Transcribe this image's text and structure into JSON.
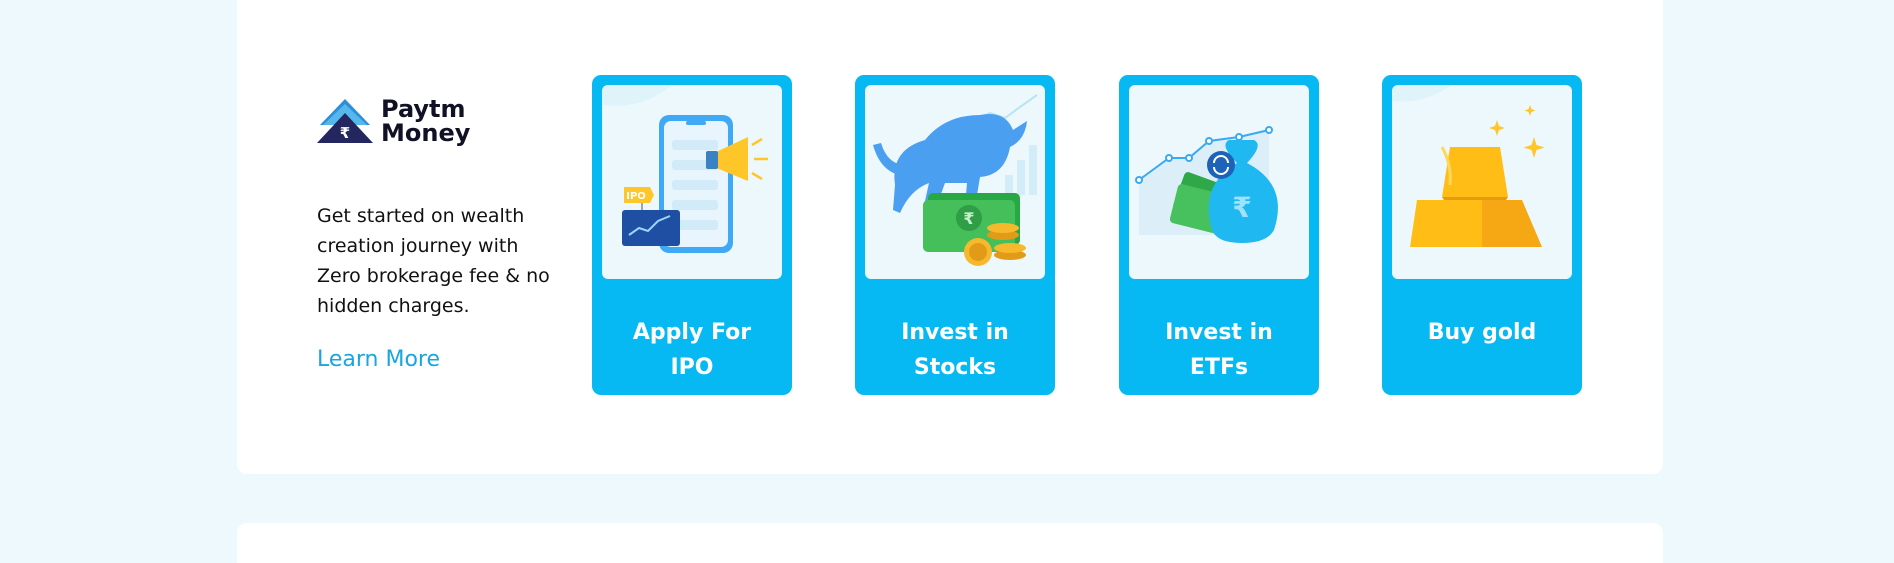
{
  "brand": {
    "line1": "Paytm",
    "line2": "Money",
    "symbol": "₹"
  },
  "intro": {
    "description": "Get started on wealth creation journey with Zero brokerage fee & no hidden charges.",
    "link": "Learn More"
  },
  "cards": [
    {
      "label": "Apply For IPO",
      "tag": "IPO",
      "icon": "phone-megaphone-icon"
    },
    {
      "label": "Invest in Stocks",
      "icon": "bull-money-icon"
    },
    {
      "label": "Invest in ETFs",
      "icon": "money-bag-chart-icon"
    },
    {
      "label": "Buy gold",
      "icon": "gold-bars-icon"
    }
  ],
  "colors": {
    "card": "#06b9f3",
    "link": "#17a6e0",
    "page_bg": "#eef9fe"
  }
}
